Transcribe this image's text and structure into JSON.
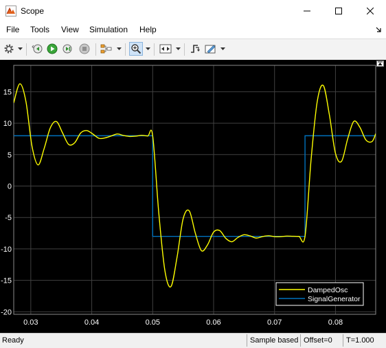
{
  "window": {
    "title": "Scope",
    "app_icon": "matlab-scope-icon",
    "controls": [
      "minimize-icon",
      "maximize-icon",
      "close-icon"
    ]
  },
  "menu": {
    "items": [
      "File",
      "Tools",
      "View",
      "Simulation",
      "Help"
    ]
  },
  "toolbar": {
    "icons": [
      "gear-icon",
      "step-back-icon",
      "run-icon",
      "step-forward-icon",
      "stop-icon",
      "signal-selector-icon",
      "zoom-in-icon",
      "autoscale-icon",
      "triggers-icon",
      "cursor-measurements-icon"
    ],
    "active": "zoom-in-icon"
  },
  "status": {
    "ready": "Ready",
    "mode": "Sample based",
    "offset": "Offset=0",
    "time": "T=1.000"
  },
  "colors": {
    "background": "#000000",
    "grid": "#404040",
    "axis_text": "#ffffff",
    "damped": "#ffff00",
    "signal": "#0072bd"
  },
  "chart_data": {
    "type": "line",
    "title": "",
    "xlabel": "",
    "ylabel": "",
    "xlim": [
      0.0272,
      0.0866
    ],
    "ylim": [
      -20.4,
      19.2
    ],
    "xticks": [
      "0.03",
      "0.04",
      "0.05",
      "0.06",
      "0.07",
      "0.08"
    ],
    "xtick_values": [
      0.03,
      0.04,
      0.05,
      0.06,
      0.07,
      0.08
    ],
    "yticks": [
      "15",
      "10",
      "5",
      "0",
      "-5",
      "-10",
      "-15",
      "-20"
    ],
    "ytick_values": [
      15,
      10,
      5,
      0,
      -5,
      -10,
      -15,
      -20
    ],
    "grid": true,
    "legend_position": "bottom-right",
    "series": [
      {
        "name": "DampedOsc",
        "color": "#ffff00",
        "x": [
          0.0272,
          0.0282,
          0.0292,
          0.0302,
          0.0312,
          0.0322,
          0.0332,
          0.0342,
          0.0352,
          0.0362,
          0.0372,
          0.0382,
          0.0392,
          0.0402,
          0.0412,
          0.0422,
          0.0432,
          0.0442,
          0.0452,
          0.0462,
          0.0472,
          0.0482,
          0.0492,
          0.05,
          0.051,
          0.052,
          0.053,
          0.054,
          0.055,
          0.056,
          0.057,
          0.058,
          0.059,
          0.06,
          0.061,
          0.062,
          0.063,
          0.064,
          0.065,
          0.066,
          0.067,
          0.068,
          0.069,
          0.07,
          0.071,
          0.072,
          0.073,
          0.074,
          0.075,
          0.076,
          0.077,
          0.078,
          0.079,
          0.08,
          0.081,
          0.082,
          0.083,
          0.084,
          0.085,
          0.086,
          0.0866
        ],
        "y": [
          13.24,
          16.27,
          13.46,
          6.32,
          3.36,
          6.0,
          9.25,
          10.27,
          8.48,
          6.63,
          6.88,
          8.45,
          8.82,
          8.26,
          7.59,
          7.66,
          7.97,
          8.28,
          8.05,
          7.89,
          7.94,
          8.06,
          7.96,
          8.0,
          -4.25,
          -13.41,
          -15.99,
          -11.32,
          -5.2,
          -3.94,
          -7.5,
          -10.28,
          -9.36,
          -7.32,
          -7.08,
          -8.32,
          -8.86,
          -8.17,
          -7.75,
          -7.94,
          -8.27,
          -8.04,
          -7.91,
          -8.05,
          -8.05,
          -7.96,
          -7.99,
          -8.01,
          -8.0,
          4.25,
          13.41,
          15.99,
          11.32,
          5.2,
          3.94,
          7.5,
          10.28,
          9.36,
          7.32,
          7.08,
          8.32
        ]
      },
      {
        "name": "SignalGenerator",
        "color": "#0072bd",
        "x": [
          0.0272,
          0.05,
          0.05,
          0.075,
          0.075,
          0.0866
        ],
        "y": [
          8,
          8,
          -8,
          -8,
          8,
          8
        ]
      }
    ]
  }
}
